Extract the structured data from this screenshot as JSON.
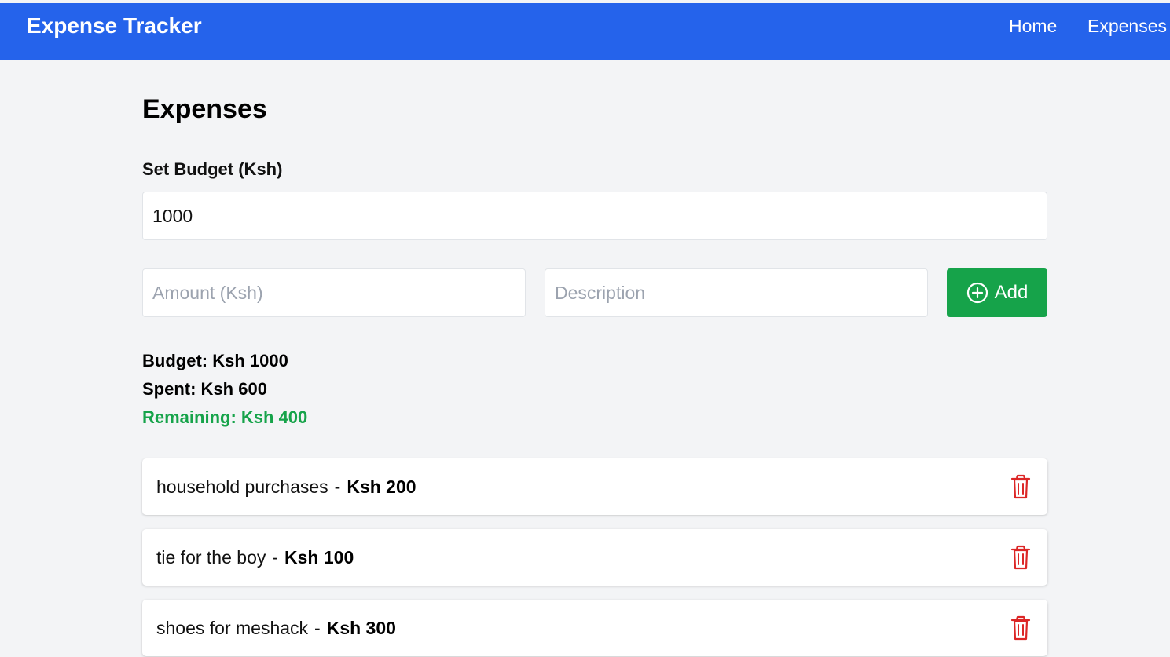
{
  "header": {
    "brand": "Expense Tracker",
    "nav": [
      "Home",
      "Expenses"
    ]
  },
  "main": {
    "title": "Expenses",
    "budget_label": "Set Budget (Ksh)",
    "budget_value": "1000",
    "amount_placeholder": "Amount (Ksh)",
    "description_placeholder": "Description",
    "add_label": "Add"
  },
  "summary": {
    "budget": "Budget: Ksh 1000",
    "spent": "Spent: Ksh 600",
    "remaining": "Remaining: Ksh 400"
  },
  "expenses": [
    {
      "description": "household purchases",
      "amount": "Ksh 200"
    },
    {
      "description": "tie for the boy",
      "amount": "Ksh 100"
    },
    {
      "description": "shoes for meshack",
      "amount": "Ksh 300"
    }
  ],
  "icons": {
    "add": "plus-circle-icon",
    "delete": "trash-icon"
  },
  "colors": {
    "header": "#2563eb",
    "background": "#f3f4f6",
    "add_button": "#16a34a",
    "remaining": "#16a34a",
    "delete": "#dc2626",
    "placeholder": "#9ca3af"
  },
  "separator": "-"
}
